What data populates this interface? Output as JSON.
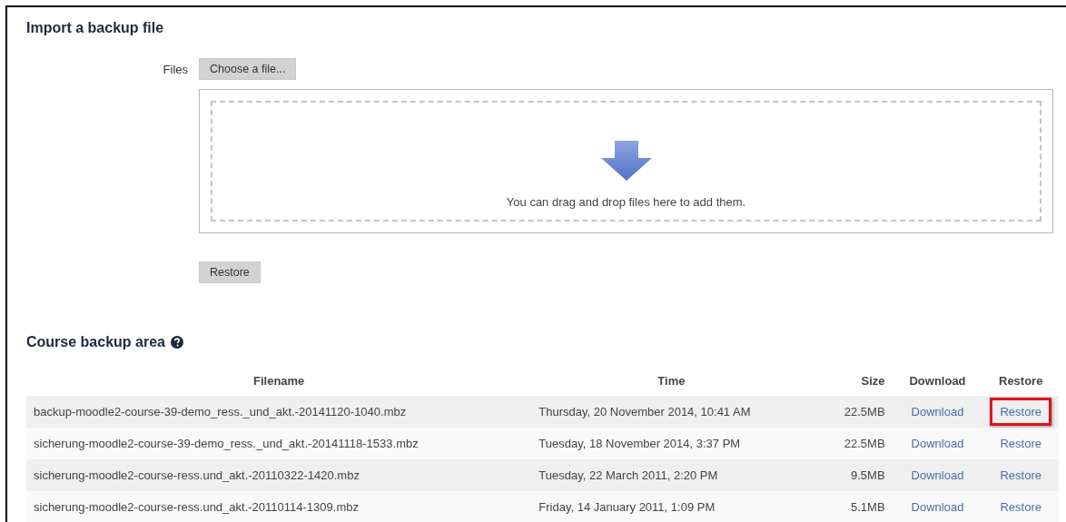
{
  "import_section": {
    "title": "Import a backup file",
    "files_label": "Files",
    "choose_button": "Choose a file...",
    "dropzone_text": "You can drag and drop files here to add them.",
    "restore_button": "Restore"
  },
  "backup_area": {
    "title": "Course backup area",
    "columns": [
      "Filename",
      "Time",
      "Size",
      "Download",
      "Restore"
    ],
    "rows": [
      {
        "filename": "backup-moodle2-course-39-demo_ress._und_akt.-20141120-1040.mbz",
        "time": "Thursday, 20 November 2014, 10:41 AM",
        "size": "22.5MB",
        "download": "Download",
        "restore": "Restore",
        "highlighted": true
      },
      {
        "filename": "sicherung-moodle2-course-39-demo_ress._und_akt.-20141118-1533.mbz",
        "time": "Tuesday, 18 November 2014, 3:37 PM",
        "size": "22.5MB",
        "download": "Download",
        "restore": "Restore",
        "highlighted": false
      },
      {
        "filename": "sicherung-moodle2-course-ress.und_akt.-20110322-1420.mbz",
        "time": "Tuesday, 22 March 2011, 2:20 PM",
        "size": "9.5MB",
        "download": "Download",
        "restore": "Restore",
        "highlighted": false
      },
      {
        "filename": "sicherung-moodle2-course-ress.und_akt.-20110114-1309.mbz",
        "time": "Friday, 14 January 2011, 1:09 PM",
        "size": "5.1MB",
        "download": "Download",
        "restore": "Restore",
        "highlighted": false
      }
    ]
  }
}
